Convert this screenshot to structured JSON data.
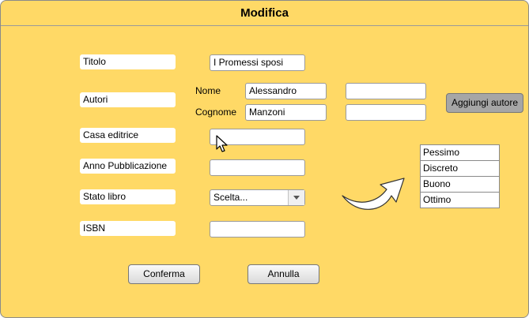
{
  "window": {
    "title": "Modifica"
  },
  "form": {
    "titolo": {
      "label": "Titolo",
      "value": "I Promessi sposi"
    },
    "autori": {
      "label": "Autori",
      "nome_label": "Nome",
      "cognome_label": "Cognome",
      "author1": {
        "nome": "Alessandro",
        "cognome": "Manzoni"
      },
      "author2": {
        "nome": "",
        "cognome": ""
      },
      "add_button": "Aggiungi autore"
    },
    "casa_editrice": {
      "label": "Casa editrice",
      "value": ""
    },
    "anno": {
      "label": "Anno Pubblicazione",
      "value": ""
    },
    "stato": {
      "label": "Stato libro",
      "selected": "Scelta..."
    },
    "isbn": {
      "label": "ISBN",
      "value": ""
    }
  },
  "dropdown_options": [
    "Pessimo",
    "Discreto",
    "Buono",
    "Ottimo"
  ],
  "actions": {
    "confirm": "Conferma",
    "cancel": "Annulla"
  },
  "colors": {
    "background": "#ffd966",
    "accent_button": "#a6a6a6"
  },
  "icons": {
    "cursor": "mouse-pointer-icon",
    "arrow": "curved-arrow-icon",
    "select": "dropdown-triangle-icon"
  }
}
